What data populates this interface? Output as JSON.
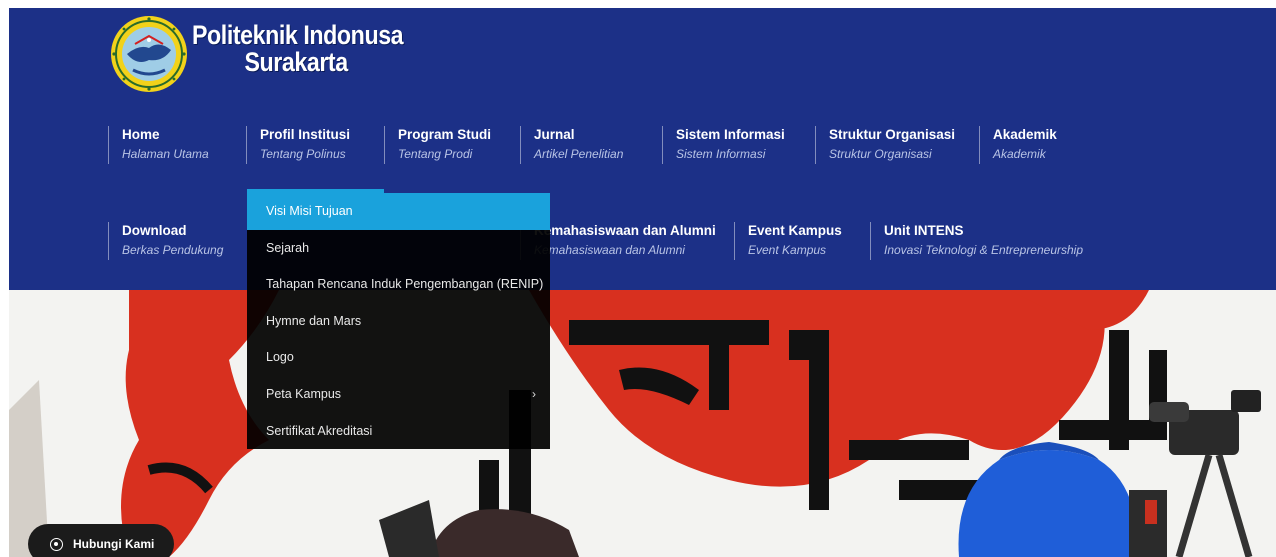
{
  "brand": {
    "line1": "Politeknik Indonusa",
    "line2": "Surakarta"
  },
  "nav_row1": [
    {
      "title": "Home",
      "subtitle": "Halaman Utama"
    },
    {
      "title": "Profil Institusi",
      "subtitle": "Tentang Polinus"
    },
    {
      "title": "Program Studi",
      "subtitle": "Tentang Prodi"
    },
    {
      "title": "Jurnal",
      "subtitle": "Artikel Penelitian"
    },
    {
      "title": "Sistem Informasi",
      "subtitle": "Sistem Informasi"
    },
    {
      "title": "Struktur Organisasi",
      "subtitle": "Struktur Organisasi"
    },
    {
      "title": "Akademik",
      "subtitle": "Akademik"
    }
  ],
  "nav_row2": [
    {
      "title": "Download",
      "subtitle": "Berkas Pendukung"
    },
    {
      "title": "Kemahasiswaan dan Alumni",
      "subtitle": "Kemahasiswaan dan Alumni"
    },
    {
      "title": "Event Kampus",
      "subtitle": "Event Kampus"
    },
    {
      "title": "Unit INTENS",
      "subtitle": "Inovasi Teknologi & Entrepreneurship"
    }
  ],
  "dropdown": {
    "items": [
      {
        "label": "Visi Misi Tujuan"
      },
      {
        "label": "Sejarah"
      },
      {
        "label": "Tahapan Rencana Induk Pengembangan (RENIP)"
      },
      {
        "label": "Hymne dan Mars"
      },
      {
        "label": "Logo"
      },
      {
        "label": "Peta Kampus",
        "chevron": "›"
      },
      {
        "label": "Sertifikat Akreditasi"
      }
    ]
  },
  "hubungi": {
    "label": "Hubungi Kami"
  },
  "colors": {
    "header": "#1c3087",
    "accent": "#1aa2dc",
    "dropdown_bg": "#000000"
  },
  "icons": {
    "whatsapp": "whatsapp-icon",
    "chevron": "chevron-right-icon",
    "logo": "polinus-logo"
  }
}
